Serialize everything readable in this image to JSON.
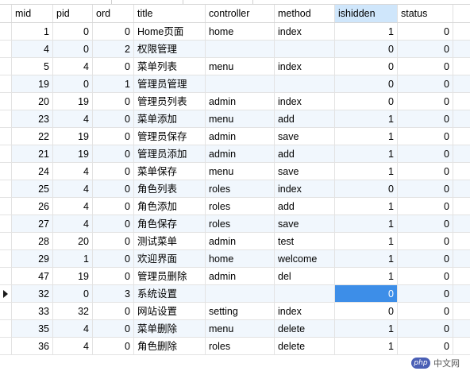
{
  "columns": [
    "mid",
    "pid",
    "ord",
    "title",
    "controller",
    "method",
    "ishidden",
    "status"
  ],
  "selected_column": "ishidden",
  "current_row": 15,
  "active_cell": {
    "row": 15,
    "col": 6
  },
  "rows": [
    [
      "1",
      "0",
      "0",
      "Home页面",
      "home",
      "index",
      "1",
      "0"
    ],
    [
      "4",
      "0",
      "2",
      "权限管理",
      "",
      "",
      "0",
      "0"
    ],
    [
      "5",
      "4",
      "0",
      "菜单列表",
      "menu",
      "index",
      "0",
      "0"
    ],
    [
      "19",
      "0",
      "1",
      "管理员管理",
      "",
      "",
      "0",
      "0"
    ],
    [
      "20",
      "19",
      "0",
      "管理员列表",
      "admin",
      "index",
      "0",
      "0"
    ],
    [
      "23",
      "4",
      "0",
      "菜单添加",
      "menu",
      "add",
      "1",
      "0"
    ],
    [
      "22",
      "19",
      "0",
      "管理员保存",
      "admin",
      "save",
      "1",
      "0"
    ],
    [
      "21",
      "19",
      "0",
      "管理员添加",
      "admin",
      "add",
      "1",
      "0"
    ],
    [
      "24",
      "4",
      "0",
      "菜单保存",
      "menu",
      "save",
      "1",
      "0"
    ],
    [
      "25",
      "4",
      "0",
      "角色列表",
      "roles",
      "index",
      "0",
      "0"
    ],
    [
      "26",
      "4",
      "0",
      "角色添加",
      "roles",
      "add",
      "1",
      "0"
    ],
    [
      "27",
      "4",
      "0",
      "角色保存",
      "roles",
      "save",
      "1",
      "0"
    ],
    [
      "28",
      "20",
      "0",
      "测试菜单",
      "admin",
      "test",
      "1",
      "0"
    ],
    [
      "29",
      "1",
      "0",
      "欢迎界面",
      "home",
      "welcome",
      "1",
      "0"
    ],
    [
      "47",
      "19",
      "0",
      "管理员删除",
      "admin",
      "del",
      "1",
      "0"
    ],
    [
      "32",
      "0",
      "3",
      "系统设置",
      "",
      "",
      "0",
      "0"
    ],
    [
      "33",
      "32",
      "0",
      "网站设置",
      "setting",
      "index",
      "0",
      "0"
    ],
    [
      "35",
      "4",
      "0",
      "菜单删除",
      "menu",
      "delete",
      "1",
      "0"
    ],
    [
      "36",
      "4",
      "0",
      "角色删除",
      "roles",
      "delete",
      "1",
      "0"
    ]
  ],
  "watermark": {
    "logo": "php",
    "text": "中文网"
  },
  "colors": {
    "selection": "#3d8ee8",
    "selected_header": "#cfe6fb",
    "alt_row": "#f1f7fd"
  }
}
